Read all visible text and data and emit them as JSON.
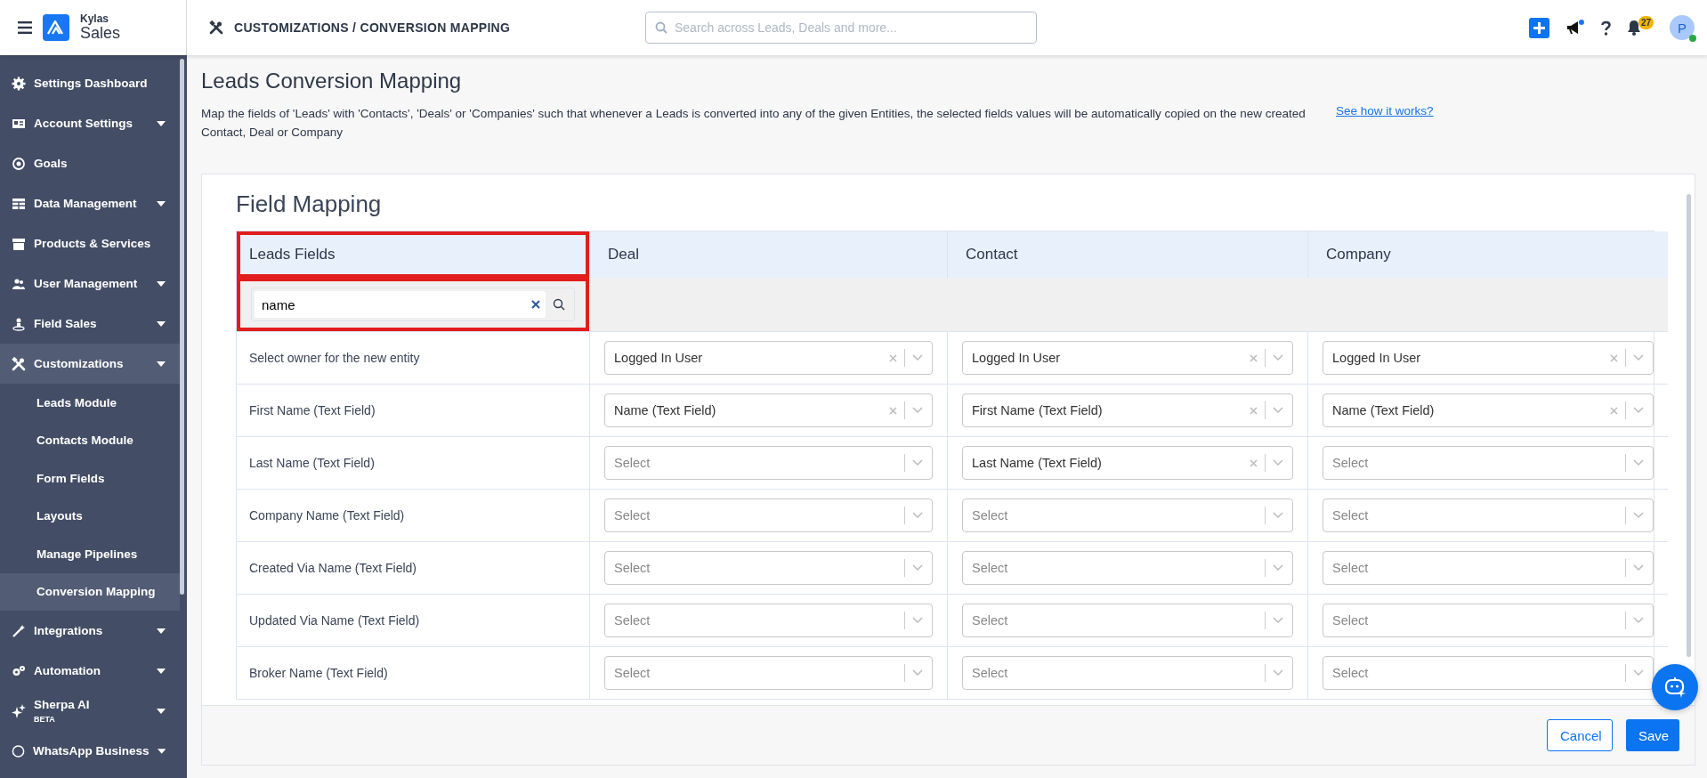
{
  "topbar": {
    "brand_small": "Kylas",
    "brand_large": "Sales",
    "breadcrumb": "CUSTOMIZATIONS / CONVERSION MAPPING",
    "search": {
      "placeholder": "Search across Leads, Deals and more..."
    },
    "notifications_count": "27",
    "announcement_unread": true,
    "avatar_initial": "P",
    "online": true
  },
  "sidebar": {
    "items": [
      {
        "label": "Settings Dashboard",
        "has_caret": false,
        "expanded": false
      },
      {
        "label": "Account Settings",
        "has_caret": true,
        "expanded": false
      },
      {
        "label": "Goals",
        "has_caret": false,
        "expanded": false
      },
      {
        "label": "Data Management",
        "has_caret": true,
        "expanded": false
      },
      {
        "label": "Products & Services",
        "has_caret": false,
        "expanded": false
      },
      {
        "label": "User Management",
        "has_caret": true,
        "expanded": false
      },
      {
        "label": "Field Sales",
        "has_caret": true,
        "expanded": false
      },
      {
        "label": "Customizations",
        "has_caret": true,
        "expanded": true,
        "children": [
          {
            "label": "Leads Module",
            "selected": false
          },
          {
            "label": "Contacts Module",
            "selected": false
          },
          {
            "label": "Form Fields",
            "selected": false
          },
          {
            "label": "Layouts",
            "selected": false
          },
          {
            "label": "Manage Pipelines",
            "selected": false
          },
          {
            "label": "Conversion Mapping",
            "selected": true
          }
        ]
      },
      {
        "label": "Integrations",
        "has_caret": true,
        "expanded": false
      },
      {
        "label": "Automation",
        "has_caret": true,
        "expanded": false
      },
      {
        "label": "Sherpa AI",
        "badge": "BETA",
        "has_caret": true,
        "expanded": false
      },
      {
        "label": "WhatsApp Business",
        "has_caret": true,
        "expanded": false
      }
    ]
  },
  "page": {
    "title": "Leads Conversion Mapping",
    "description": "Map the fields of 'Leads' with 'Contacts', 'Deals' or 'Companies' such that whenever a Leads is converted into any of the given Entities, the selected fields values will be automatically copied on the new created Contact, Deal or Company",
    "help_link": "See how it works?"
  },
  "mapping": {
    "title": "Field Mapping",
    "columns": [
      "Leads Fields",
      "Deal",
      "Contact",
      "Company"
    ],
    "filter": {
      "value": "name"
    },
    "rows": [
      {
        "cells": [
          {
            "label": "Select owner for the new entity"
          },
          {
            "value": "Logged In User"
          },
          {
            "value": "Logged In User"
          },
          {
            "value": "Logged In User"
          }
        ]
      },
      {
        "cells": [
          {
            "label": "First Name (Text Field)"
          },
          {
            "value": "Name (Text Field)"
          },
          {
            "value": "First Name (Text Field)"
          },
          {
            "value": "Name (Text Field)"
          }
        ]
      },
      {
        "cells": [
          {
            "label": "Last Name (Text Field)"
          },
          {
            "placeholder": "Select"
          },
          {
            "value": "Last Name (Text Field)"
          },
          {
            "placeholder": "Select"
          }
        ]
      },
      {
        "cells": [
          {
            "label": "Company Name (Text Field)"
          },
          {
            "placeholder": "Select"
          },
          {
            "placeholder": "Select"
          },
          {
            "placeholder": "Select"
          }
        ]
      },
      {
        "cells": [
          {
            "label": "Created Via Name (Text Field)"
          },
          {
            "placeholder": "Select"
          },
          {
            "placeholder": "Select"
          },
          {
            "placeholder": "Select"
          }
        ]
      },
      {
        "cells": [
          {
            "label": "Updated Via Name (Text Field)"
          },
          {
            "placeholder": "Select"
          },
          {
            "placeholder": "Select"
          },
          {
            "placeholder": "Select"
          }
        ]
      },
      {
        "cells": [
          {
            "label": "Broker Name (Text Field)"
          },
          {
            "placeholder": "Select"
          },
          {
            "placeholder": "Select"
          },
          {
            "placeholder": "Select"
          }
        ]
      }
    ],
    "buttons": [
      {
        "kind": "secondary",
        "label": "Cancel"
      },
      {
        "kind": "primary",
        "label": "Save"
      }
    ]
  }
}
